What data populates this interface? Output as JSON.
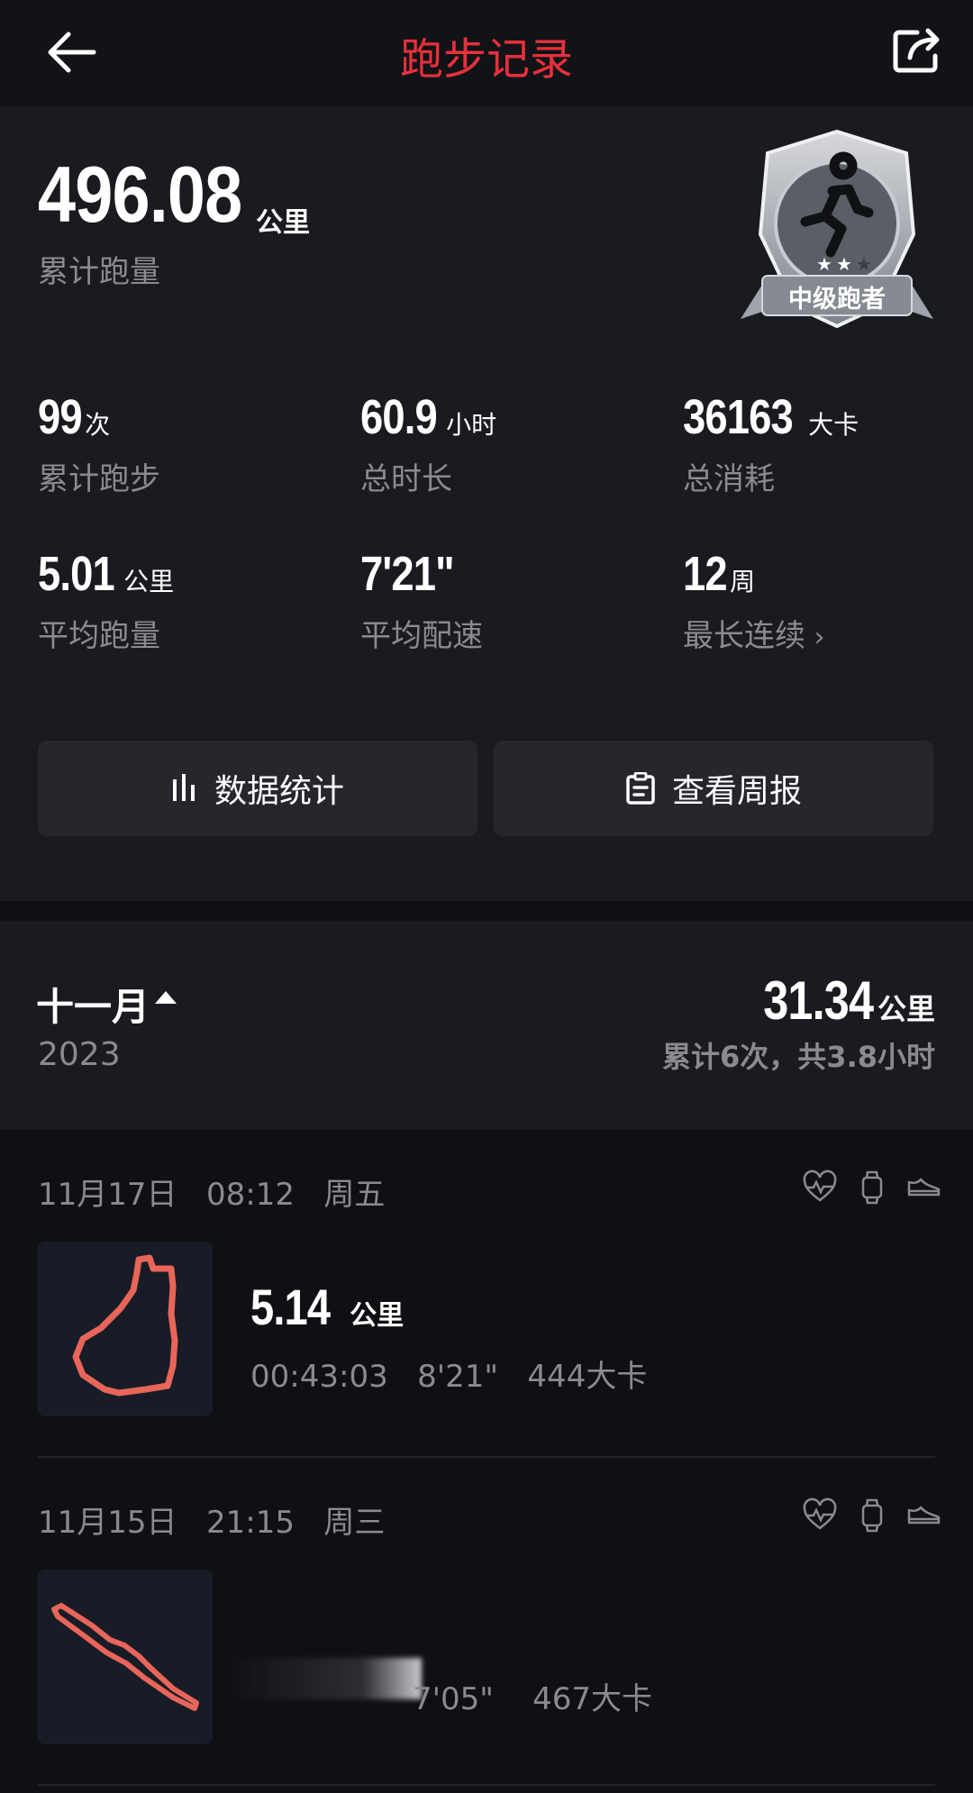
{
  "header": {
    "title": "跑步记录"
  },
  "summary": {
    "total_distance": "496.08",
    "total_distance_unit": "公里",
    "total_distance_label": "累计跑量",
    "badge_label": "中级跑者",
    "badge_stars": 2,
    "stats": [
      {
        "value": "99",
        "unit": "次",
        "label": "累计跑步"
      },
      {
        "value": "60.9",
        "unit": "小时",
        "label": "总时长"
      },
      {
        "value": "36163",
        "unit": "大卡",
        "label": "总消耗"
      },
      {
        "value": "5.01",
        "unit": "公里",
        "label": "平均跑量"
      },
      {
        "value": "7'21\"",
        "unit": "",
        "label": "平均配速"
      },
      {
        "value": "12",
        "unit": "周",
        "label": "最长连续"
      }
    ],
    "buttons": {
      "stats_label": "数据统计",
      "weekly_label": "查看周报"
    }
  },
  "month": {
    "name": "十一月",
    "year": "2023",
    "distance": "31.34",
    "distance_unit": "公里",
    "summary": "累计6次，共3.8小时"
  },
  "records": [
    {
      "date": "11月17日",
      "time": "08:12",
      "weekday": "周五",
      "distance": "5.14",
      "distance_unit": "公里",
      "meta": "00:43:03   8'21\"   444大卡"
    },
    {
      "date": "11月15日",
      "time": "21:15",
      "weekday": "周三",
      "distance": "",
      "distance_unit": "",
      "meta": "7'05\"    467大卡"
    }
  ],
  "colors": {
    "accent": "#e8303c",
    "route": "#e8655a",
    "muted": "#8a8b90",
    "panel": "#1a1b20",
    "background": "#0f1013"
  }
}
